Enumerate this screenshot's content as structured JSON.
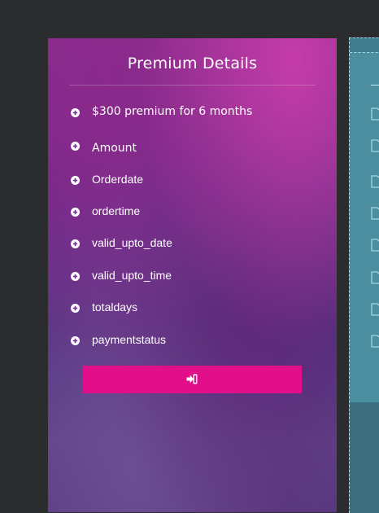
{
  "card": {
    "title": "Premium Details",
    "items": [
      {
        "label": "$300 premium for 6 months",
        "icon": "plus-circle-icon"
      },
      {
        "label": "Amount",
        "icon": "plus-circle-icon"
      },
      {
        "label": "Orderdate",
        "icon": "plus-circle-icon"
      },
      {
        "label": "ordertime",
        "icon": "plus-circle-icon"
      },
      {
        "label": "valid_upto_date",
        "icon": "plus-circle-icon"
      },
      {
        "label": "valid_upto_time",
        "icon": "plus-circle-icon"
      },
      {
        "label": "totaldays",
        "icon": "plus-circle-icon"
      },
      {
        "label": "paymentstatus",
        "icon": "plus-circle-icon"
      }
    ],
    "button": {
      "icon": "sign-in-icon",
      "color": "#e20f8b"
    }
  },
  "colors": {
    "background": "#2b2c2e",
    "card_top": "#8a2f8c",
    "card_bottom": "#5a3880",
    "side_panel": "#4b8ea0"
  }
}
